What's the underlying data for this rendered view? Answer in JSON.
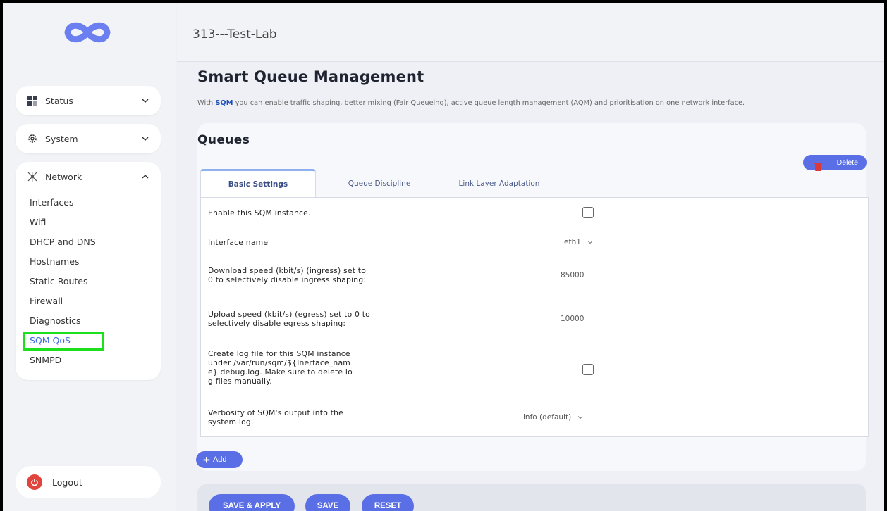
{
  "header": {
    "title": "313---Test-Lab"
  },
  "sidebar": {
    "status_label": "Status",
    "system_label": "System",
    "network_label": "Network",
    "network_items": [
      {
        "label": "Interfaces"
      },
      {
        "label": "Wifi"
      },
      {
        "label": "DHCP and DNS"
      },
      {
        "label": "Hostnames"
      },
      {
        "label": "Static Routes"
      },
      {
        "label": "Firewall"
      },
      {
        "label": "Diagnostics"
      },
      {
        "label": "SQM QoS"
      },
      {
        "label": "SNMPD"
      }
    ],
    "active_item": "SQM QoS",
    "logout_label": "Logout"
  },
  "page": {
    "title": "Smart Queue Management",
    "desc_prefix": "With ",
    "desc_link": "SQM",
    "desc_suffix": " you can enable traffic shaping, better mixing (Fair Queueing), active queue length management (AQM) and prioritisation on one network interface."
  },
  "section": {
    "title": "Queues",
    "delete_label": "Delete",
    "tabs": [
      {
        "label": "Basic Settings"
      },
      {
        "label": "Queue Discipline"
      },
      {
        "label": "Link Layer Adaptation"
      }
    ],
    "active_tab": "Basic Settings",
    "fields": {
      "enable": {
        "label": "Enable this SQM instance.",
        "checked": false
      },
      "interface": {
        "label": "Interface name",
        "value": "eth1"
      },
      "download": {
        "label": "Download speed (kbit/s) (ingress) set to 0 to selectively disable ingress shaping:",
        "value": "85000"
      },
      "upload": {
        "label": "Upload speed (kbit/s) (egress) set to 0 to selectively disable egress shaping:",
        "value": "10000"
      },
      "logfile": {
        "label": "Create log file for this SQM instance under /var/run/sqm/${Inerface_name}.debug.log. Make sure to delete log files manually.",
        "checked": false
      },
      "verbosity": {
        "label": "Verbosity of SQM's output into the system log.",
        "value": "info (default)"
      }
    },
    "add_label": "Add"
  },
  "footer": {
    "save_apply_label": "SAVE & APPLY",
    "save_label": "SAVE",
    "reset_label": "RESET"
  },
  "colors": {
    "accent": "#5a6fe6",
    "highlight": "#1de01d",
    "logout_icon": "#e0443a",
    "delete_icon": "#d9393b"
  },
  "icons": {
    "logo": "infinity-logo-icon",
    "status": "grid-icon",
    "system": "gear-icon",
    "network": "network-icon",
    "logout": "power-icon",
    "delete": "trash-icon",
    "add": "plus-icon"
  }
}
